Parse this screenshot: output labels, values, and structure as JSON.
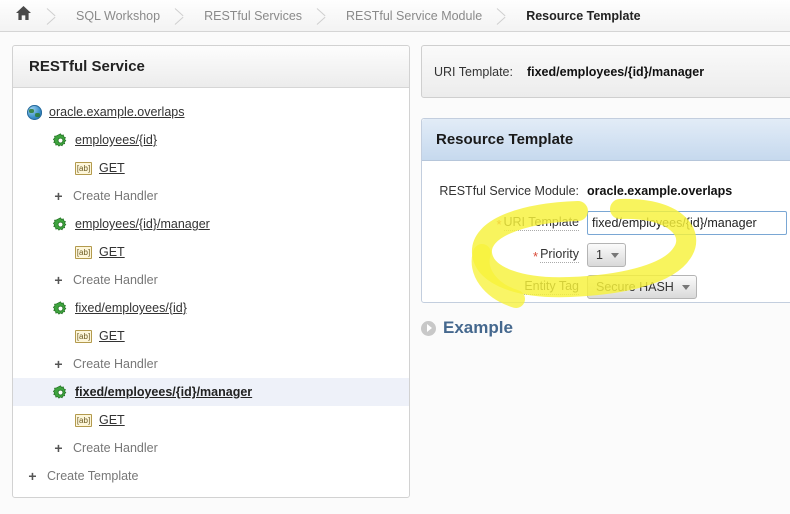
{
  "breadcrumb": {
    "home_icon": "home-icon",
    "items": [
      {
        "label": "SQL Workshop",
        "active": false
      },
      {
        "label": "RESTful Services",
        "active": false
      },
      {
        "label": "RESTful Service Module",
        "active": false
      },
      {
        "label": "Resource Template",
        "active": true
      }
    ]
  },
  "tree_panel": {
    "title": "RESTful Service",
    "nodes": [
      {
        "label": "oracle.example.overlaps",
        "icon": "globe-icon",
        "level": 1,
        "selected": false,
        "link": true
      },
      {
        "label": "employees/{id}",
        "icon": "gear-icon",
        "level": 2,
        "selected": false,
        "link": true
      },
      {
        "label": "GET",
        "icon": "ab-tag-icon",
        "level": 3,
        "selected": false,
        "link": true
      },
      {
        "label": "Create Handler",
        "icon": "plus-icon",
        "level": 3,
        "selected": false,
        "link": false
      },
      {
        "label": "employees/{id}/manager",
        "icon": "gear-icon",
        "level": 2,
        "selected": false,
        "link": true
      },
      {
        "label": "GET",
        "icon": "ab-tag-icon",
        "level": 3,
        "selected": false,
        "link": true
      },
      {
        "label": "Create Handler",
        "icon": "plus-icon",
        "level": 3,
        "selected": false,
        "link": false
      },
      {
        "label": "fixed/employees/{id}",
        "icon": "gear-icon",
        "level": 2,
        "selected": false,
        "link": true
      },
      {
        "label": "GET",
        "icon": "ab-tag-icon",
        "level": 3,
        "selected": false,
        "link": true
      },
      {
        "label": "Create Handler",
        "icon": "plus-icon",
        "level": 3,
        "selected": false,
        "link": false
      },
      {
        "label": "fixed/employees/{id}/manager",
        "icon": "gear-icon",
        "level": 2,
        "selected": true,
        "link": true
      },
      {
        "label": "GET",
        "icon": "ab-tag-icon",
        "level": 3,
        "selected": false,
        "link": true
      },
      {
        "label": "Create Handler",
        "icon": "plus-icon",
        "level": 3,
        "selected": false,
        "link": false
      },
      {
        "label": "Create Template",
        "icon": "plus-icon",
        "level": 1,
        "selected": false,
        "link": false
      }
    ]
  },
  "uri_summary": {
    "label": "URI Template:",
    "value": "fixed/employees/{id}/manager"
  },
  "resource_template": {
    "title": "Resource Template",
    "module_label": "RESTful Service Module:",
    "module_value": "oracle.example.overlaps",
    "uri_template_label": "URI Template",
    "uri_template_value": "fixed/employees/{id}/manager",
    "uri_template_placeholder": "",
    "priority_label": "Priority",
    "priority_value": "1",
    "entity_tag_label": "Entity Tag",
    "entity_tag_value": "Secure HASH",
    "required_marker": "*"
  },
  "example_section": {
    "title": "Example",
    "disclosure_icon": "disclosure-right-icon"
  },
  "colors": {
    "highlighter": "#f7f23b",
    "required_star": "#d94a38",
    "link": "#333333",
    "region_header_start": "#e2ecf7",
    "region_header_end": "#c6d9ee",
    "selected_row": "#eef1f9",
    "example_title": "#45688e"
  }
}
